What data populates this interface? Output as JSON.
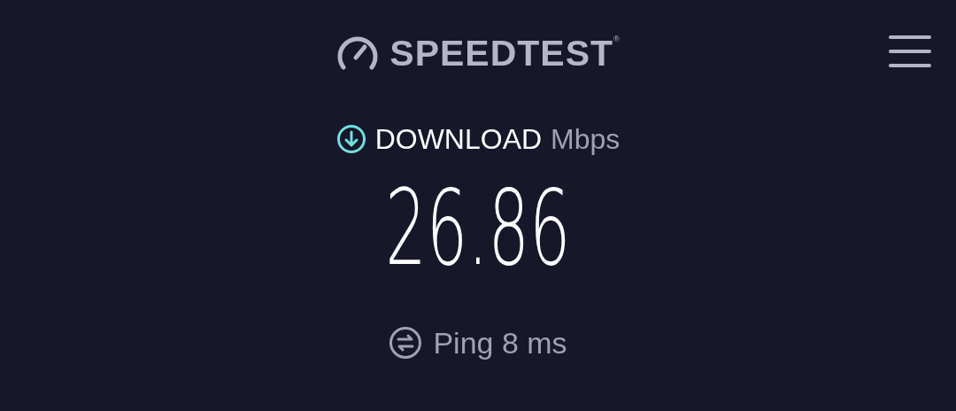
{
  "header": {
    "title": "SPEEDTEST",
    "trademark": "®"
  },
  "result": {
    "label": "DOWNLOAD",
    "unit": "Mbps",
    "value": "26.86"
  },
  "ping": {
    "label": "Ping 8 ms"
  }
}
